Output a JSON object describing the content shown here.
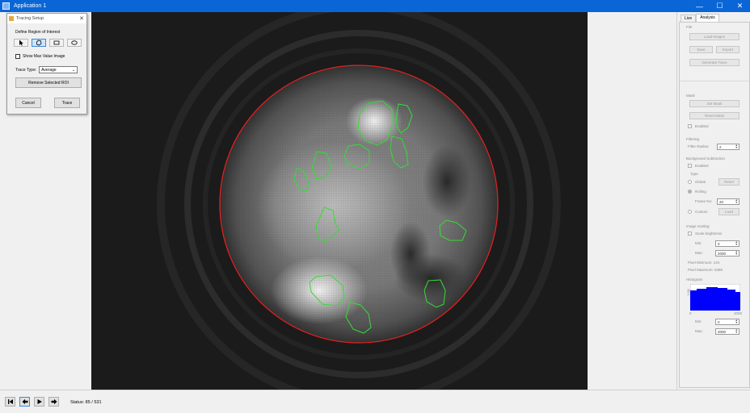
{
  "window": {
    "title": "Application 1",
    "minimize_glyph": "—",
    "maximize_glyph": "☐",
    "close_glyph": "✕"
  },
  "tracing_setup": {
    "title": "Tracing Setup",
    "close_glyph": "✕",
    "define_roi_label": "Define Region of Interest",
    "tools": [
      "pointer-tool",
      "polygon-tool",
      "rectangle-tool",
      "ellipse-tool"
    ],
    "selected_tool": "polygon-tool",
    "show_max_label": "Show Max Value Image",
    "show_max_checked": false,
    "trace_type_label": "Trace Type:",
    "trace_type_value": "Average",
    "remove_roi_label": "Remove Selected ROI",
    "cancel_label": "Cancel",
    "trace_label": "Trace"
  },
  "panel": {
    "tabs": [
      "Live",
      "Analysis"
    ],
    "active_tab": "Analysis",
    "file": {
      "label": "File",
      "load_images": "Load Images",
      "save": "Save",
      "export": "Export",
      "generate_trace": "Generate Trace"
    },
    "mask": {
      "label": "Mask",
      "set_mask": "Set Mask",
      "reset_mask": "Reset Mask",
      "enabled": "Enabled"
    },
    "filtering": {
      "label": "Filtering",
      "filter_radius_label": "Filter Radius:",
      "filter_radius": "2"
    },
    "background": {
      "label": "Background Subtraction",
      "enabled": "Enabled",
      "type_label": "Type",
      "global": "Global",
      "reset": "Reset",
      "rolling": "Rolling",
      "frame_no_label": "Frame No:",
      "frame_no": "20",
      "custom": "Custom",
      "load": "Load"
    },
    "scaling": {
      "label": "Image Scaling",
      "scale_brightness": "Scale brightness",
      "min_label": "Min:",
      "min": "0",
      "max_label": "Max:",
      "max": "2000",
      "pixel_minimum": "Pixel Minimum: 134",
      "pixel_maximum": "Pixel Maximum: 5389"
    },
    "histogram": {
      "label": "Histogram",
      "y_axis_label": "Log",
      "x_min": "0",
      "x_max": "2000",
      "bar_color": "#0000ff",
      "min_label": "Min:",
      "min": "0",
      "max_label": "Max:",
      "max": "2000"
    }
  },
  "status": {
    "label": "Status:",
    "value": "85 / 531",
    "text": "Status: 85 / 531"
  },
  "colors": {
    "accent": "#0a66d6",
    "roi": "#33dd33",
    "mask_circle": "#e02020"
  }
}
